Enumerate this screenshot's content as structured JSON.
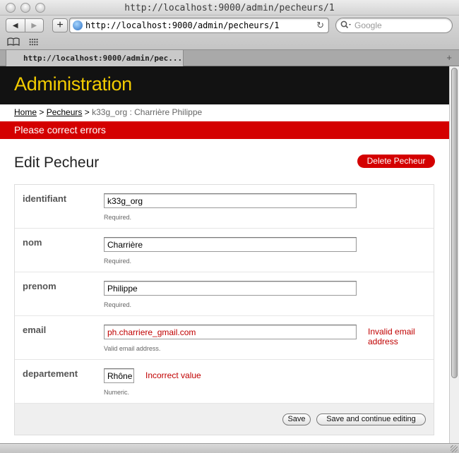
{
  "browser": {
    "window_title": "http://localhost:9000/admin/pecheurs/1",
    "url": "http://localhost:9000/admin/pecheurs/1",
    "search_placeholder": "Google",
    "tab_title": "http://localhost:9000/admin/pec...",
    "back_glyph": "◀",
    "forward_glyph": "▶",
    "new_tab_glyph": "+",
    "reload_glyph": "↻",
    "search_icon": "search-icon",
    "bookmarks_icon": "open-book-icon",
    "top_sites_icon": "grid-icon"
  },
  "header": {
    "title": "Administration",
    "bg_color": "#121212",
    "title_color": "#f2cb00"
  },
  "breadcrumb": {
    "home": "Home",
    "sep1": " > ",
    "section": "Pecheurs",
    "sep2": " > ",
    "current": "k33g_org : Charrière Philippe"
  },
  "error_banner": {
    "text": "Please correct errors",
    "color": "#d40000"
  },
  "page": {
    "title": "Edit Pecheur",
    "delete_label": "Delete Pecheur"
  },
  "form": {
    "fields": [
      {
        "label": "identifiant",
        "value": "k33g_org",
        "help": "Required.",
        "error": ""
      },
      {
        "label": "nom",
        "value": "Charrière",
        "help": "Required.",
        "error": ""
      },
      {
        "label": "prenom",
        "value": "Philippe",
        "help": "Required.",
        "error": ""
      },
      {
        "label": "email",
        "value": "ph.charriere_gmail.com",
        "help": "Valid email address.",
        "error_line1": "Invalid email",
        "error_line2": "address"
      },
      {
        "label": "departement",
        "value": "Rhône",
        "help": "Numeric.",
        "error": "Incorrect value"
      }
    ],
    "save_label": "Save",
    "save_continue_label": "Save and continue editing",
    "error_color": "#c00000"
  }
}
